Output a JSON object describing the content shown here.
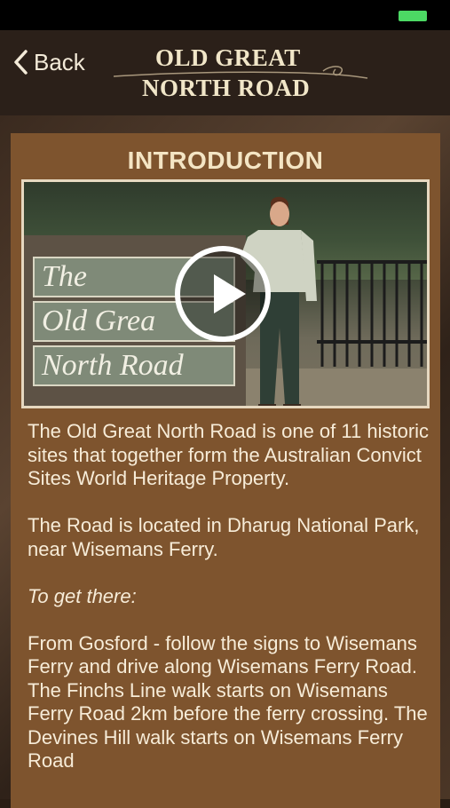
{
  "status_bar": {
    "battery_color": "#4cd964"
  },
  "nav": {
    "back_label": "Back",
    "logo_line1": "OLD GREAT",
    "logo_line2": "NORTH ROAD"
  },
  "content": {
    "heading": "INTRODUCTION",
    "video": {
      "sign_lines": [
        "The",
        "Old Grea",
        "North Road"
      ],
      "play_icon": "play-icon"
    },
    "paragraphs": [
      "The Old Great North Road is one of 11 historic sites that together form the Australian Convict Sites World Heritage Property.",
      "The Road is located in Dharug National Park, near Wisemans Ferry.",
      "To get there:",
      "From Gosford - follow the signs to Wisemans Ferry and drive along Wisemans Ferry Road. The Finchs Line walk starts on Wisemans Ferry Road 2km before the ferry crossing.  The Devines Hill walk starts on Wisemans Ferry Road"
    ]
  },
  "colors": {
    "panel": "#7e542e",
    "navbar": "#2b2019",
    "text": "#f7ecd8"
  }
}
